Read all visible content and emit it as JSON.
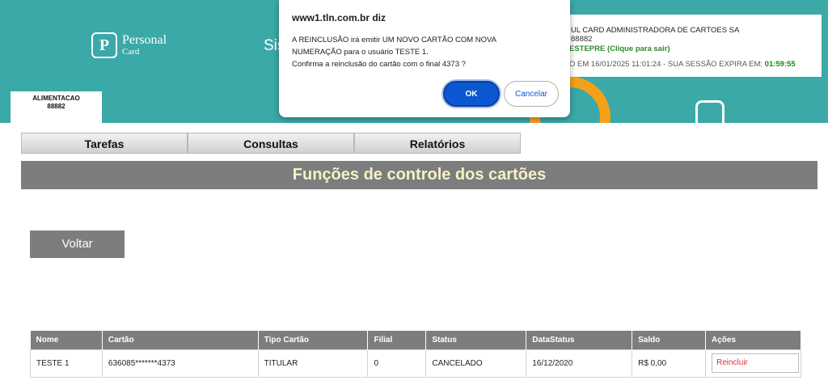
{
  "header": {
    "logo_mark": "P",
    "logo_line1": "Personal",
    "logo_line2": "Card",
    "system_text": "Sis",
    "company": "UL CARD ADMINISTRADORA DE CARTOES SA",
    "code": "88882",
    "user_link": "ESTEPRE (Clique para sair)",
    "session_prefix": "O EM 16/01/2025 11:01:24 -   SUA SESSÃO EXPIRA EM:",
    "session_timer": "01:59:55",
    "colors": {
      "teal": "#3aa9a7",
      "orange": "#f5a01a"
    }
  },
  "card_tab": {
    "line1": "ALIMENTACAO",
    "line2": "88882"
  },
  "menu": {
    "items": [
      "Tarefas",
      "Consultas",
      "Relatórios"
    ]
  },
  "page_title": "Funções de controle dos cartões",
  "back_button": "Voltar",
  "table": {
    "headers": [
      "Nome",
      "Cartão",
      "Tipo Cartão",
      "Filial",
      "Status",
      "DataStatus",
      "Saldo",
      "Ações"
    ],
    "rows": [
      {
        "nome": "TESTE 1",
        "cartao": "636085*******4373",
        "tipo": "TITULAR",
        "filial": "0",
        "status": "CANCELADO",
        "data_status": "16/12/2020",
        "saldo": "R$ 0,00",
        "acao": "Reincluir"
      }
    ]
  },
  "dialog": {
    "title": "www1.tln.com.br diz",
    "line1": "A REINCLUSÃO irá emitir UM NOVO CARTÃO COM NOVA",
    "line2": "NUMERAÇÃO para o usuário TESTE 1.",
    "line3": "Confirma a reinclusão do cartão com o final 4373 ?",
    "ok": "OK",
    "cancel": "Cancelar"
  }
}
